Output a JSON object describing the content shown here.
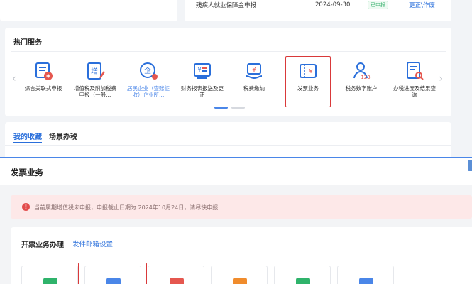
{
  "declaration": {
    "name": "残疾人就业保障金申报",
    "date": "2024-09-30",
    "status": "已申报",
    "action": "更正\\作废"
  },
  "hot_services": {
    "title": "热门服务",
    "items": [
      {
        "label": "综合关联式申报",
        "icon": "report-doc-icon"
      },
      {
        "label": "增值税及附加税费申报（一般...",
        "icon": "vat-edit-icon"
      },
      {
        "label": "居民企业（查账征收）企业所...",
        "icon": "enterprise-tax-icon"
      },
      {
        "label": "财务报表报送及更正",
        "icon": "financial-report-icon"
      },
      {
        "label": "税费缴纳",
        "icon": "tax-payment-icon"
      },
      {
        "label": "发票业务",
        "icon": "invoice-icon"
      },
      {
        "label": "税务数字账户",
        "icon": "digital-account-icon"
      },
      {
        "label": "办税进度及结果查询",
        "icon": "progress-query-icon"
      }
    ]
  },
  "favorites": {
    "tabs": [
      "我的收藏",
      "场景办税"
    ],
    "active_tab": "我的收藏"
  },
  "invoice_page": {
    "title": "发票业务",
    "alert": "当前属期增值税未申报，申报截止日期为 2024年10月24日，请尽快申报",
    "section_title": "开票业务办理",
    "section_link": "发件邮箱设置",
    "tile_colors": [
      "#2fb36b",
      "#4a86e8",
      "#e5574f",
      "#f08c2c",
      "#2fb36b",
      "#4a86e8"
    ]
  },
  "colors": {
    "accent": "#2a6fdb",
    "highlight_border": "#d9393a",
    "alert_bg": "#fde8e8"
  }
}
